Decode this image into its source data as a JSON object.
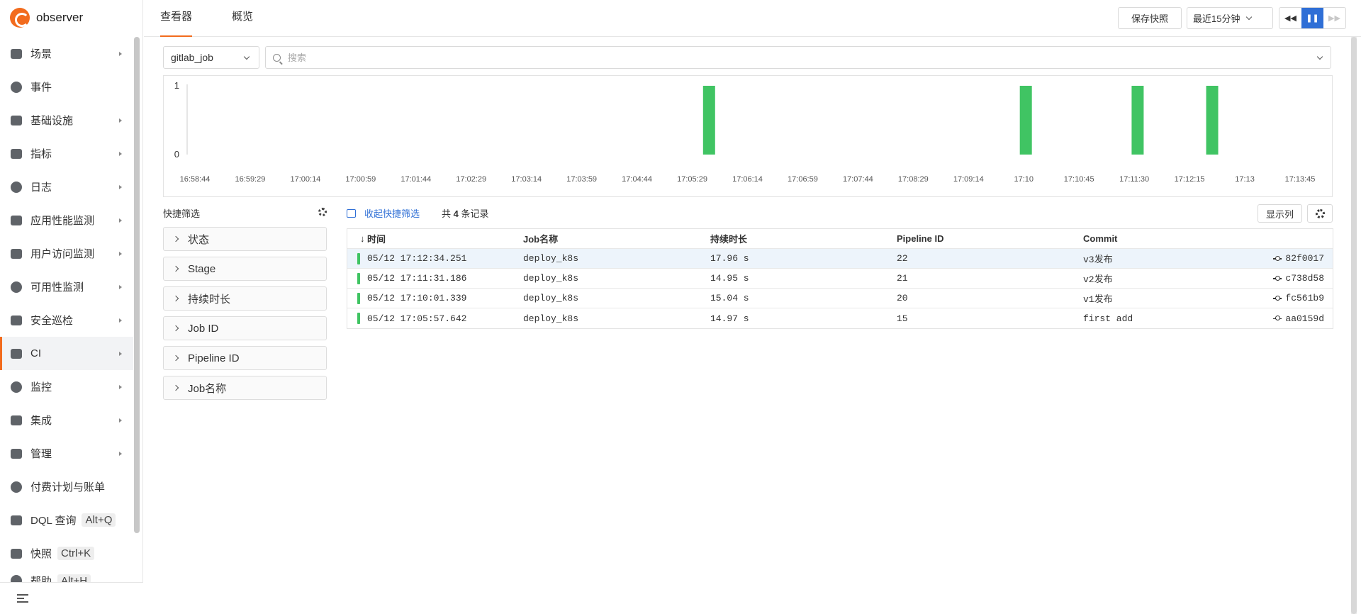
{
  "app": {
    "name": "observer"
  },
  "sidebar": {
    "items": [
      {
        "label": "场景",
        "icon": "dashboard-icon",
        "arrow": true
      },
      {
        "label": "事件",
        "icon": "bell-icon",
        "arrow": false
      },
      {
        "label": "基础设施",
        "icon": "infrastructure-icon",
        "arrow": true
      },
      {
        "label": "指标",
        "icon": "metrics-icon",
        "arrow": true
      },
      {
        "label": "日志",
        "icon": "log-icon",
        "arrow": true
      },
      {
        "label": "应用性能监测",
        "icon": "apm-icon",
        "arrow": true
      },
      {
        "label": "用户访问监测",
        "icon": "rum-icon",
        "arrow": true
      },
      {
        "label": "可用性监测",
        "icon": "availability-icon",
        "arrow": true
      },
      {
        "label": "安全巡检",
        "icon": "shield-icon",
        "arrow": true
      },
      {
        "label": "CI",
        "icon": "rocket-icon",
        "arrow": true,
        "active": true
      },
      {
        "label": "监控",
        "icon": "monitor-icon",
        "arrow": true
      },
      {
        "label": "集成",
        "icon": "integration-icon",
        "arrow": true
      },
      {
        "label": "管理",
        "icon": "settings-sliders-icon",
        "arrow": true
      },
      {
        "label": "付费计划与账单",
        "icon": "billing-icon",
        "arrow": false
      },
      {
        "label": "DQL 查询",
        "icon": "compass-icon",
        "arrow": false,
        "shortcut": "Alt+Q"
      },
      {
        "label": "快照",
        "icon": "camera-icon",
        "arrow": false,
        "shortcut": "Ctrl+K"
      },
      {
        "label": "帮助",
        "icon": "help-icon",
        "arrow": false,
        "shortcut": "Alt+H"
      }
    ]
  },
  "header": {
    "tabs": [
      {
        "label": "查看器",
        "active": true
      },
      {
        "label": "概览",
        "active": false
      }
    ],
    "save_snapshot": "保存快照",
    "time_range": "最近15分钟"
  },
  "toolbar": {
    "source": "gitlab_job",
    "search_placeholder": "搜索"
  },
  "chart_data": {
    "type": "bar",
    "x_tick_labels": [
      "16:58:44",
      "16:59:29",
      "17:00:14",
      "17:00:59",
      "17:01:44",
      "17:02:29",
      "17:03:14",
      "17:03:59",
      "17:04:44",
      "17:05:29",
      "17:06:14",
      "17:06:59",
      "17:07:44",
      "17:08:29",
      "17:09:14",
      "17:10",
      "17:10:45",
      "17:11:30",
      "17:12:15",
      "17:13",
      "17:13:45"
    ],
    "y_ticks": [
      0,
      1
    ],
    "ylim": [
      0,
      1
    ],
    "xlim": [
      "16:58:44",
      "17:13:45"
    ],
    "bars": [
      {
        "x": "17:05:45",
        "value": 1
      },
      {
        "x": "17:10:00",
        "value": 1
      },
      {
        "x": "17:11:30",
        "value": 1
      },
      {
        "x": "17:12:30",
        "value": 1
      }
    ],
    "color": "#40c463"
  },
  "quick_filter": {
    "title": "快捷筛选",
    "items": [
      "状态",
      "Stage",
      "持续时长",
      "Job ID",
      "Pipeline ID",
      "Job名称"
    ]
  },
  "list": {
    "collapse_label": "收起快捷筛选",
    "records_prefix": "共",
    "records_count": "4",
    "records_suffix": "条记录",
    "show_columns": "显示列",
    "columns": [
      "时间",
      "Job名称",
      "持续时长",
      "Pipeline ID",
      "Commit"
    ],
    "sort_indicator": "↓",
    "rows": [
      {
        "time": "05/12 17:12:34.251",
        "job": "deploy_k8s",
        "duration": "17.96 s",
        "pipeline_id": "22",
        "commit": "v3发布",
        "hash": "82f0017",
        "status_color": "#40c463",
        "selected": true
      },
      {
        "time": "05/12 17:11:31.186",
        "job": "deploy_k8s",
        "duration": "14.95 s",
        "pipeline_id": "21",
        "commit": "v2发布",
        "hash": "c738d58",
        "status_color": "#40c463",
        "selected": false
      },
      {
        "time": "05/12 17:10:01.339",
        "job": "deploy_k8s",
        "duration": "15.04 s",
        "pipeline_id": "20",
        "commit": "v1发布",
        "hash": "fc561b9",
        "status_color": "#40c463",
        "selected": false
      },
      {
        "time": "05/12 17:05:57.642",
        "job": "deploy_k8s",
        "duration": "14.97 s",
        "pipeline_id": "15",
        "commit": "first add",
        "hash": "aa0159d",
        "status_color": "#40c463",
        "selected": false
      }
    ]
  }
}
